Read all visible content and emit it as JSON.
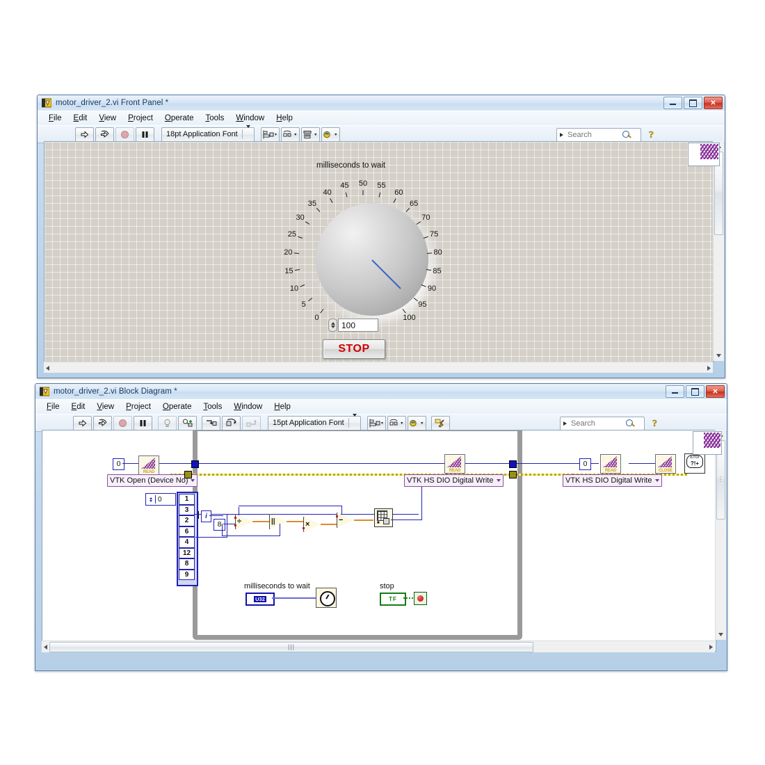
{
  "front_panel": {
    "title": "motor_driver_2.vi Front Panel *",
    "icon_name": "labview-vi-icon",
    "window_buttons": [
      "minimize",
      "maximize",
      "close"
    ],
    "menu": [
      "File",
      "Edit",
      "View",
      "Project",
      "Operate",
      "Tools",
      "Window",
      "Help"
    ],
    "toolbar": {
      "run_label": "run-arrow",
      "run_continuous_label": "run-continuously",
      "abort_label": "abort-execution",
      "pause_label": "pause",
      "font_selector": "18pt Application Font",
      "align_label": "align-objects",
      "distribute_label": "distribute-objects",
      "resize_label": "resize-objects",
      "reorder_label": "reorder"
    },
    "search": {
      "placeholder": "Search",
      "value": ""
    },
    "help_button": "?",
    "dial": {
      "label": "milliseconds to wait",
      "min": 0,
      "max": 100,
      "tick_labels": [
        "0",
        "5",
        "10",
        "15",
        "20",
        "25",
        "30",
        "35",
        "40",
        "45",
        "50",
        "55",
        "60",
        "65",
        "70",
        "75",
        "80",
        "85",
        "90",
        "95",
        "100"
      ],
      "value": 100,
      "needle_value": 100
    },
    "numeric_display": {
      "value": "100"
    },
    "stop_button": {
      "label": "STOP"
    }
  },
  "block_diagram": {
    "title": "motor_driver_2.vi Block Diagram *",
    "icon_name": "labview-vi-icon",
    "window_buttons": [
      "minimize",
      "maximize",
      "close"
    ],
    "menu": [
      "File",
      "Edit",
      "View",
      "Project",
      "Operate",
      "Tools",
      "Window",
      "Help"
    ],
    "toolbar": {
      "run_label": "run-arrow",
      "run_continuous_label": "run-continuously",
      "abort_label": "abort-execution",
      "pause_label": "pause",
      "highlight_label": "highlight-execution",
      "retain_wire_label": "retain-wire-values",
      "step_into_label": "step-into",
      "step_over_label": "step-over",
      "step_out_label": "step-out",
      "font_selector": "15pt Application Font",
      "align_label": "align-objects",
      "distribute_label": "distribute-objects",
      "reorder_label": "reorder",
      "cleanup_label": "clean-up-diagram"
    },
    "search": {
      "placeholder": "Search",
      "value": ""
    },
    "help_button": "?",
    "nodes": {
      "device_no_constant": "0",
      "vtk_open": "VTK Open (Device No)",
      "vtk_write_1": "VTK HS DIO Digital Write",
      "vtk_write_2": "VTK HS DIO Digital Write",
      "write2_constant": "0",
      "vtk_close_label": "CLOSE",
      "vtk_read_label": "READ",
      "error_handler": {
        "line1": "Error",
        "line2": "?!+"
      },
      "index_value": "0",
      "array_values": [
        "1",
        "3",
        "2",
        "6",
        "4",
        "12",
        "8",
        "9"
      ],
      "iteration_terminal": "i",
      "divisor_constant": "8",
      "op_divide": "÷",
      "op_or": "||",
      "op_multiply": "×",
      "op_subtract": "−",
      "bool_array_label": "boolean-array-to-number"
    },
    "terminals": {
      "ms_to_wait_label": "milliseconds to wait",
      "ms_to_wait_type": "U32",
      "wait_node": "wait-ms-timer",
      "stop_label": "stop",
      "stop_type": "TF",
      "stop_led": "stop-indicator"
    }
  }
}
